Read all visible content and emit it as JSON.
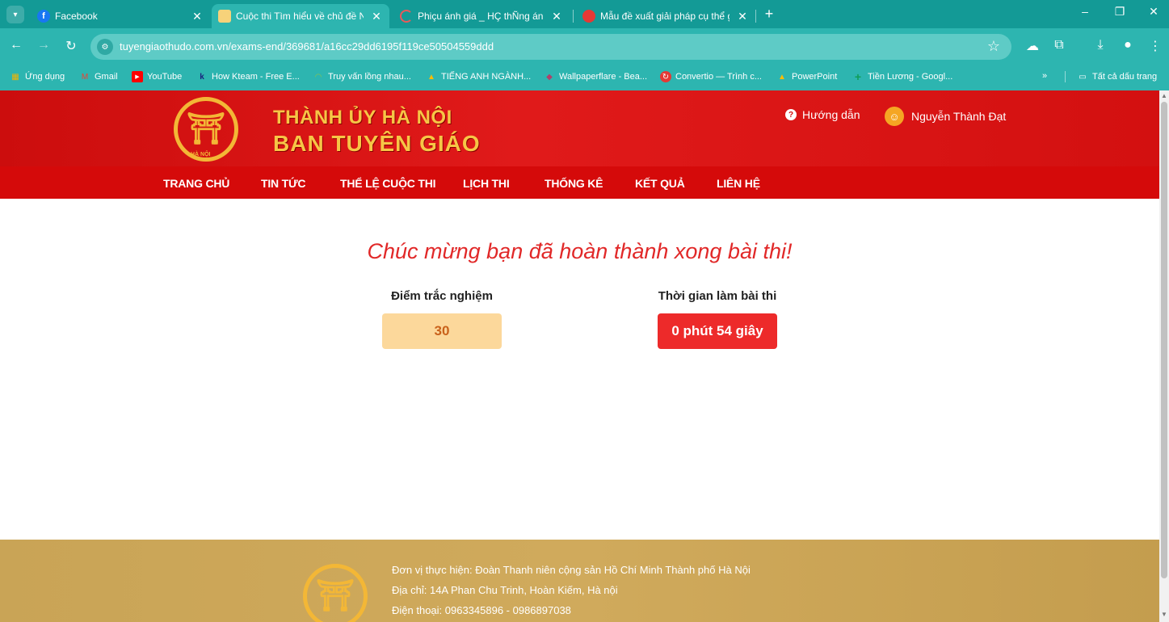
{
  "browser": {
    "tabs": [
      {
        "title": "Facebook",
        "favicon": "facebook-icon",
        "active": false
      },
      {
        "title": "Cuộc thi Tìm hiểu về chủ đề Ng",
        "favicon": "site-icon",
        "active": true
      },
      {
        "title": "Phiçu ánh giá _ HÇ thÑng ánh g",
        "favicon": "loading-icon",
        "active": false
      },
      {
        "title": "Mẫu đề xuất giải pháp cụ thể g",
        "favicon": "red-circle-icon",
        "active": false
      }
    ],
    "new_tab": "+",
    "url": "tuyengiaothudo.com.vn/exams-end/369681/a16cc29dd6195f119ce50504559ddd",
    "bookmarks": [
      {
        "label": "Ứng dụng",
        "icon": "apps-grid-icon",
        "color": "#f4b400"
      },
      {
        "label": "Gmail",
        "icon": "gmail-icon",
        "color": "#ea4335"
      },
      {
        "label": "YouTube",
        "icon": "youtube-icon",
        "color": "#ff0000"
      },
      {
        "label": "How Kteam - Free E...",
        "icon": "kteam-icon",
        "color": "#1a237e"
      },
      {
        "label": "Truy vấn lồng nhau...",
        "icon": "query-icon",
        "color": "#8bc34a"
      },
      {
        "label": "TIẾNG ANH NGÀNH...",
        "icon": "drive-icon",
        "color": "#fbbc04"
      },
      {
        "label": "Wallpaperflare - Bea...",
        "icon": "wallpaper-icon",
        "color": "#7b3fa0"
      },
      {
        "label": "Convertio — Trình c...",
        "icon": "convertio-icon",
        "color": "#e53935"
      },
      {
        "label": "PowerPoint",
        "icon": "drive-icon",
        "color": "#fbbc04"
      },
      {
        "label": "Tiền Lương - Googl...",
        "icon": "sheets-plus-icon",
        "color": "#0f9d58"
      }
    ],
    "more_bookmarks": "»",
    "all_bookmarks": "Tất cả dấu trang"
  },
  "site": {
    "logo_sub": "HÀ NỘI",
    "org_line1": "THÀNH ỦY HÀ NỘI",
    "org_line2": "BAN TUYÊN GIÁO",
    "help_label": "Hướng dẫn",
    "user_name": "Nguyễn Thành Đạt",
    "menu": [
      "TRANG CHỦ",
      "TIN TỨC",
      "THỂ LỆ CUỘC THI",
      "LỊCH THI",
      "THỐNG KÊ",
      "KẾT QUẢ",
      "LIÊN HỆ"
    ]
  },
  "result": {
    "congrats": "Chúc mừng bạn đã hoàn thành xong bài thi!",
    "score_label": "Điểm trắc nghiệm",
    "score_value": "30",
    "time_label": "Thời gian làm bài thi",
    "time_value": "0 phút 54 giây"
  },
  "footer": {
    "unit": "Đơn vị thực hiện: Đoàn Thanh niên cộng sản Hồ Chí Minh Thành phố Hà Nội",
    "address": "Địa chỉ: 14A Phan Chu Trinh, Hoàn Kiếm, Hà nội",
    "phone": "Điện thoại: 0963345896 - 0986897038"
  },
  "colors": {
    "chrome": "#139a96",
    "header_red": "#d50a0a",
    "gold": "#f6c646",
    "congrats": "#e12828",
    "score_bg": "#fcd89b",
    "time_bg": "#ed2a2a",
    "footer": "#c9a456"
  }
}
